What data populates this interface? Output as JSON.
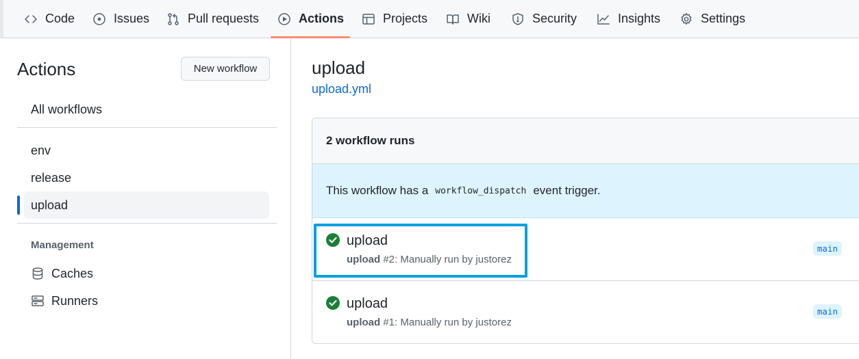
{
  "nav": {
    "tabs": [
      {
        "label": "Code",
        "icon": "code-icon"
      },
      {
        "label": "Issues",
        "icon": "issue-circle-icon"
      },
      {
        "label": "Pull requests",
        "icon": "pull-request-icon"
      },
      {
        "label": "Actions",
        "icon": "play-circle-icon",
        "selected": true
      },
      {
        "label": "Projects",
        "icon": "table-icon"
      },
      {
        "label": "Wiki",
        "icon": "book-icon"
      },
      {
        "label": "Security",
        "icon": "shield-icon"
      },
      {
        "label": "Insights",
        "icon": "graph-icon"
      },
      {
        "label": "Settings",
        "icon": "gear-icon"
      }
    ],
    "accent_color": "#fd8c73"
  },
  "sidebar": {
    "title": "Actions",
    "new_workflow_label": "New workflow",
    "all_workflows_label": "All workflows",
    "workflows": [
      "env",
      "release",
      "upload"
    ],
    "active_workflow": "upload",
    "management_heading": "Management",
    "management_items": [
      {
        "label": "Caches",
        "icon": "database-icon"
      },
      {
        "label": "Runners",
        "icon": "server-icon"
      }
    ]
  },
  "main": {
    "workflow_name": "upload",
    "workflow_file": "upload.yml",
    "runs_count_label": "2 workflow runs",
    "dispatch_notice": {
      "prefix": "This workflow has a",
      "code": "workflow_dispatch",
      "suffix": "event trigger."
    },
    "runs": [
      {
        "title": "upload",
        "workflow": "upload",
        "detail": "#2: Manually run by justorez",
        "branch": "main",
        "status": "success"
      },
      {
        "title": "upload",
        "workflow": "upload",
        "detail": "#1: Manually run by justorez",
        "branch": "main",
        "status": "success"
      }
    ],
    "success_color": "#1a7f37",
    "highlight_color": "#0aa0de"
  }
}
